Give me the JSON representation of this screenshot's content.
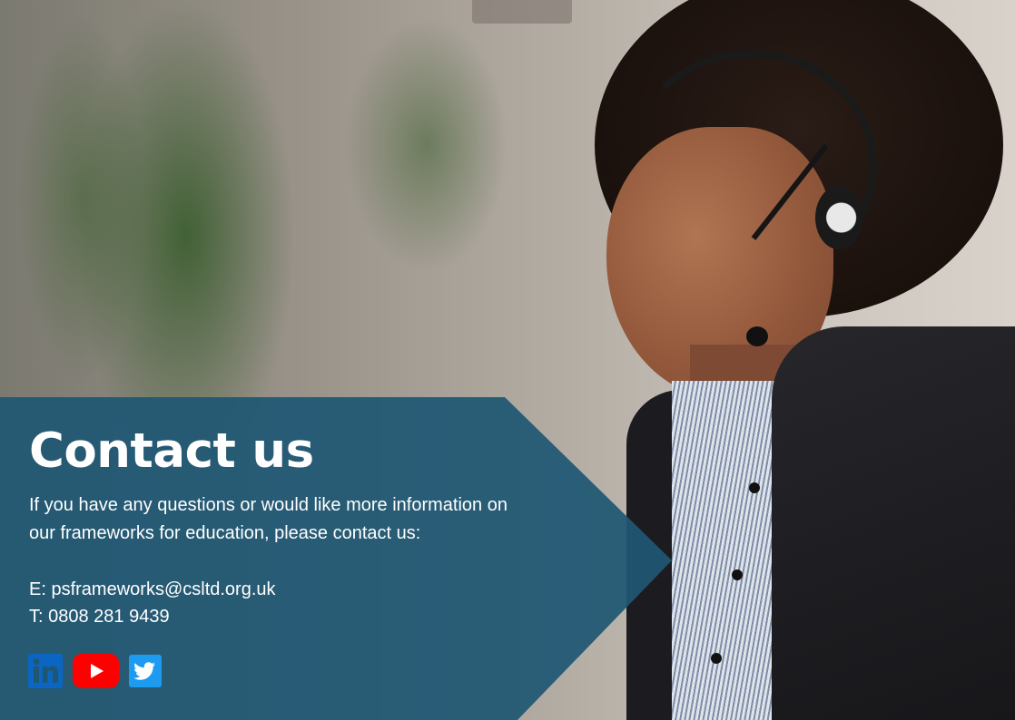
{
  "contact": {
    "heading": "Contact us",
    "intro_line1": "If you have any questions or would like more information on",
    "intro_line2": "our frameworks for education, please contact us:",
    "email_label": "E:",
    "email": "psframeworks@csltd.org.uk",
    "phone_label": "T:",
    "phone": "0808 281 9439"
  },
  "social": [
    {
      "icon": "linkedin-icon",
      "color": "#0a66c2"
    },
    {
      "icon": "youtube-icon",
      "color": "#ff0000"
    },
    {
      "icon": "twitter-icon",
      "color": "#1d9bf0"
    }
  ],
  "colors": {
    "panel": "#1f5773",
    "text": "#ffffff"
  }
}
